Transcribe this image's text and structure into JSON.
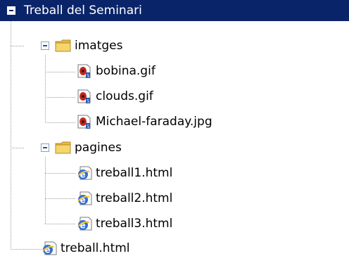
{
  "tree": {
    "root": {
      "label": "Treball del Seminari",
      "expanded": true,
      "icon": "minus-expander-icon"
    },
    "folders": [
      {
        "label": "imatges",
        "icon": "folder-icon",
        "expanded": true,
        "children": [
          {
            "label": "bobina.gif",
            "icon": "image-file-icon"
          },
          {
            "label": "clouds.gif",
            "icon": "image-file-icon"
          },
          {
            "label": "Michael-faraday.jpg",
            "icon": "image-file-icon"
          }
        ]
      },
      {
        "label": "pagines",
        "icon": "folder-icon",
        "expanded": true,
        "children": [
          {
            "label": "treball1.html",
            "icon": "html-file-icon"
          },
          {
            "label": "treball2.html",
            "icon": "html-file-icon"
          },
          {
            "label": "treball3.html",
            "icon": "html-file-icon"
          }
        ]
      }
    ],
    "files": [
      {
        "label": "treball.html",
        "icon": "html-file-icon"
      }
    ]
  },
  "colors": {
    "selection": "#0a246a",
    "selection_text": "#ffffff",
    "dotted_lines": "#9e9e9e",
    "folder_yellow": "#f6d56b"
  }
}
